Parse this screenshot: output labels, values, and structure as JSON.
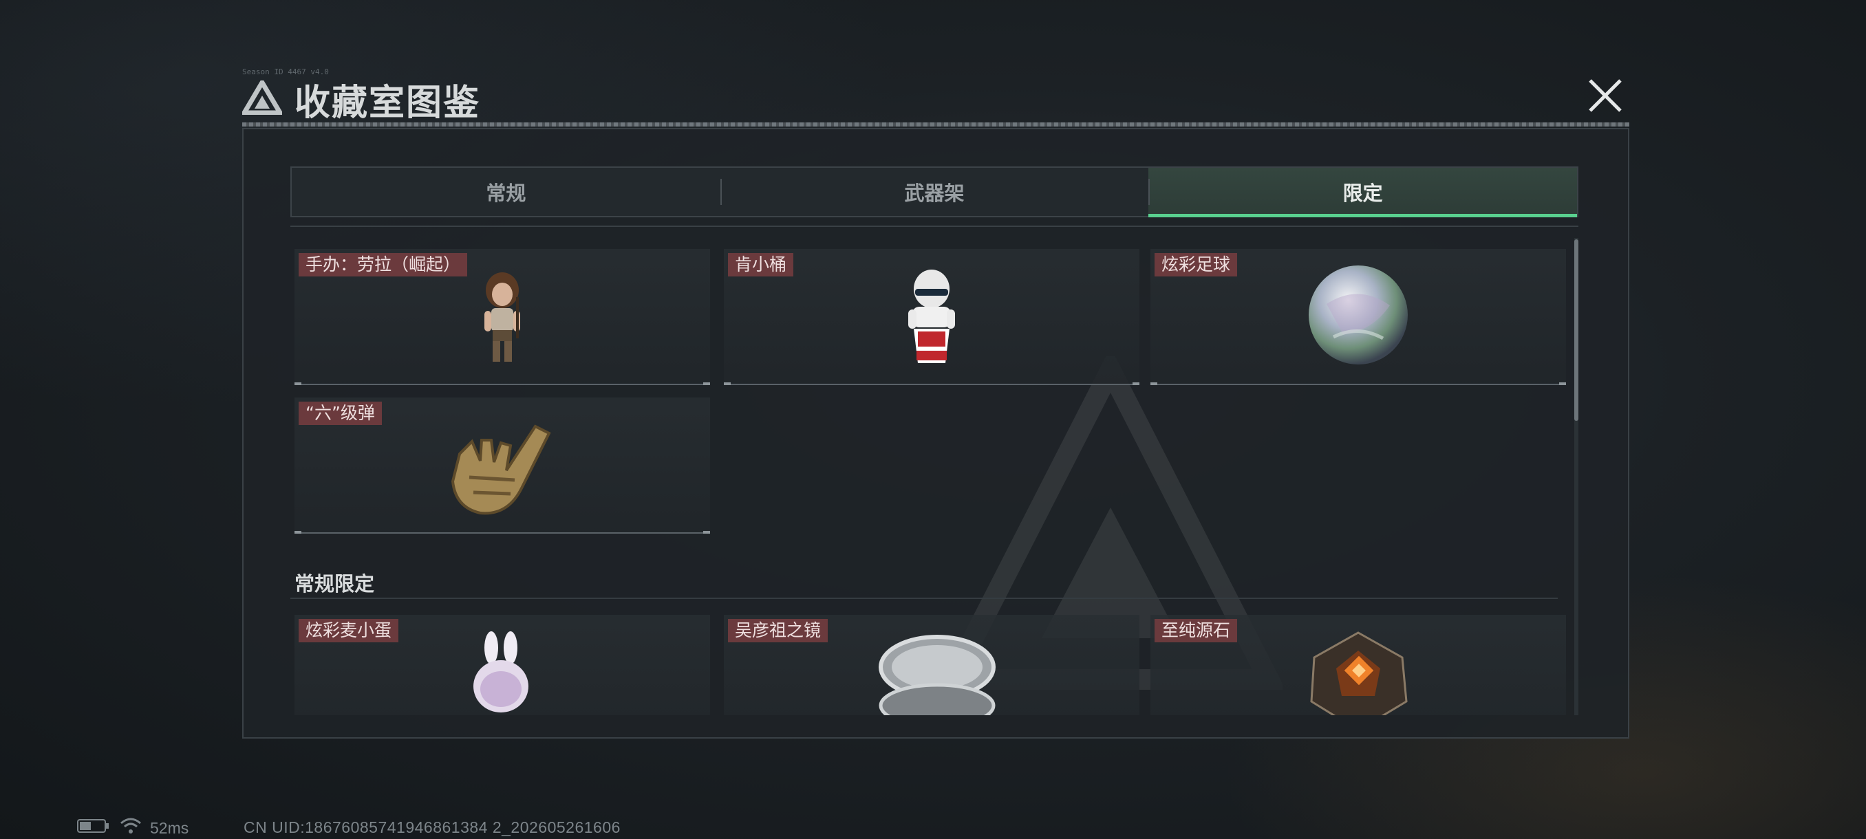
{
  "window": {
    "title": "收藏室图鉴",
    "small_caption": "Season ID 4467 v4.0"
  },
  "tabs": [
    {
      "label": "常规",
      "active": false
    },
    {
      "label": "武器架",
      "active": false
    },
    {
      "label": "限定",
      "active": true
    }
  ],
  "limited_items": [
    {
      "name": "手办：劳拉（崛起）",
      "icon": "tomb-raider-figure-icon"
    },
    {
      "name": "肯小桶",
      "icon": "kfc-colonel-figure-icon"
    },
    {
      "name": "炫彩足球",
      "icon": "iridescent-ball-icon"
    },
    {
      "name": "“六”级弹",
      "icon": "golden-hand-gesture-icon"
    }
  ],
  "section": {
    "title": "常规限定"
  },
  "regular_limited_items": [
    {
      "name": "炫彩麦小蛋",
      "icon": "bunny-figure-icon"
    },
    {
      "name": "吴彦祖之镜",
      "icon": "compact-mirror-icon"
    },
    {
      "name": "至纯源石",
      "icon": "glowing-crystal-icon"
    }
  ],
  "status_bar": {
    "ping": "52ms",
    "uid": "CN UID:18676085741946861384 2_202605261606"
  },
  "colors": {
    "accent_green": "#59d08f",
    "tag_red": "#6b3a3d"
  }
}
